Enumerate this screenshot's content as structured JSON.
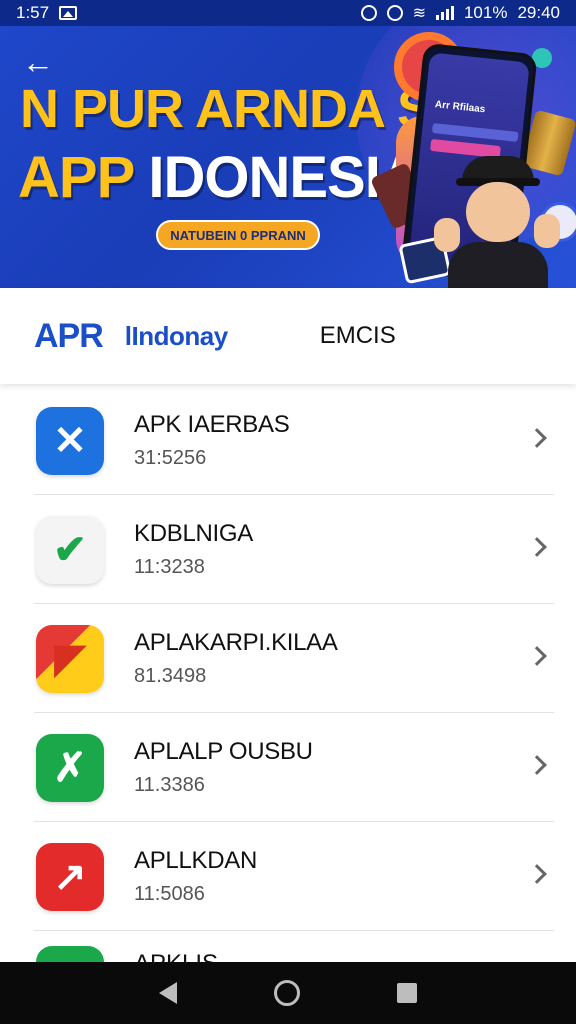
{
  "status_bar": {
    "time_left": "1:57",
    "battery": "101%",
    "clock": "29:40",
    "icons": [
      "image-icon",
      "alarm-icon",
      "sync-icon",
      "wifi-icon",
      "signal-icon"
    ]
  },
  "banner": {
    "back_icon": "back-arrow-icon",
    "headline_line1": "N PUR ARNDA SIA",
    "headline_line2_yellow": "APP",
    "headline_line2_white": "IDONESIA",
    "cta_label": "NATUBEIN 0 PPRANN",
    "phone_title": "Arr Rfilaas",
    "colors": {
      "background": "#1f47c9",
      "accent_yellow": "#ffc21a",
      "cta": "#f5a623"
    }
  },
  "tabs": {
    "logo": "APR",
    "name": "lIndonay",
    "emcis": "EMCIS"
  },
  "apps": [
    {
      "name": "APK IAERBAS",
      "meta": "31:5256",
      "icon": "x-icon",
      "color": "#1e72e0"
    },
    {
      "name": "KDBLNIGA",
      "meta": "11:3238",
      "icon": "leaf-icon",
      "color": "#f4f4f4"
    },
    {
      "name": "APLAKARPI.KILAA",
      "meta": "81.3498",
      "icon": "mail-icon",
      "color": "#ffcc1a"
    },
    {
      "name": "APLALP OUSBU",
      "meta": "11.3386",
      "icon": "check-icon",
      "color": "#1aa84a"
    },
    {
      "name": "APLLKDAN",
      "meta": "11:5086",
      "icon": "arrow-icon",
      "color": "#e32b2b"
    }
  ],
  "partial_app": {
    "name": "APKLIS..."
  },
  "nav_bar": {
    "icons": [
      "back-icon",
      "home-icon",
      "recents-icon"
    ]
  }
}
